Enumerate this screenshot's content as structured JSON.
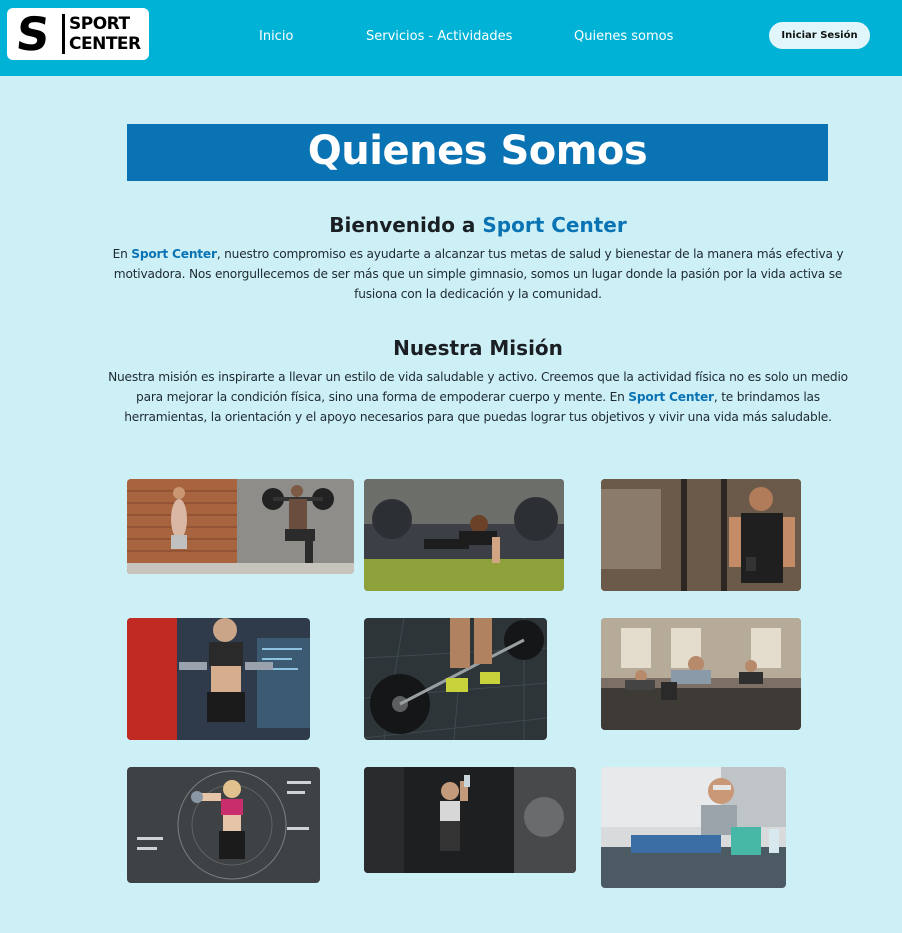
{
  "header": {
    "logo_letter": "S",
    "logo_line1": "SPORT",
    "logo_line2": "CENTER",
    "nav": [
      "Inicio",
      "Servicios - Actividades",
      "Quienes somos"
    ],
    "login_label": "Iniciar Sesión"
  },
  "banner": {
    "title": "Quienes Somos"
  },
  "welcome": {
    "heading_prefix": "Bienvenido a ",
    "heading_brand": "Sport Center",
    "p_prefix": "En ",
    "p_brand": "Sport Center",
    "p_rest": ", nuestro compromiso es ayudarte a alcanzar tus metas de salud y bienestar de la manera más efectiva y motivadora. Nos enorgullecemos de ser más que un simple gimnasio, somos un lugar donde la pasión por la vida activa se fusiona con la dedicación y la comunidad."
  },
  "mision": {
    "heading": "Nuestra Misión",
    "p_prefix": "Nuestra misión es inspirarte a llevar un estilo de vida saludable y activo. Creemos que la actividad física no es solo un medio para mejorar la condición física, sino una forma de empoderar cuerpo y mente. En ",
    "p_brand": "Sport Center",
    "p_rest": ", te brindamos las herramientas, la orientación y el apoyo necesarios para que puedas lograr tus objetivos y vivir una vida más saludable."
  },
  "colors": {
    "header_bg": "#00b3d6",
    "page_bg": "#cdf0f7",
    "banner_bg": "#0a73b4",
    "brand_text": "#0a73b4"
  },
  "gallery": [
    "photo-brick-wall-lunge-barbell",
    "photo-woman-plank-gym",
    "photo-man-phone-gym",
    "photo-woman-dumbbells-interface",
    "photo-barbell-deadlift-floor",
    "photo-group-pushups-class",
    "photo-woman-curl-dumbbell-hud",
    "photo-woman-drinking-dark-gym",
    "photo-woman-stretching-floor"
  ]
}
